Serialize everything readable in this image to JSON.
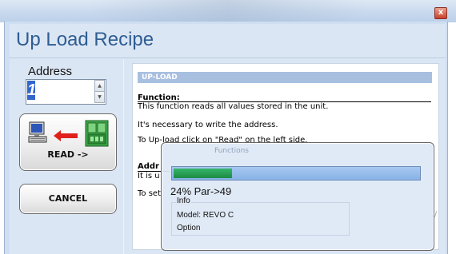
{
  "window": {
    "close_glyph": "x"
  },
  "title": "Up Load Recipe",
  "address": {
    "label": "Address",
    "value": "1"
  },
  "buttons": {
    "read_label": "READ ->",
    "cancel_label": "CANCEL"
  },
  "icons": {
    "pc": "computer-icon",
    "arrow": "red-arrow-left-icon",
    "unit": "unit-device-icon"
  },
  "info": {
    "header": "UP-LOAD",
    "function_title": "Function:",
    "function_text": "This function reads all values stored in the unit.",
    "line2": "It's necessary to write the address.",
    "line3": "To Up-load click on \"Read\" on the left side.",
    "address_title": "Addr",
    "line4": "It is u",
    "line5": "To set"
  },
  "progress": {
    "ghost_title": "Functions",
    "percent": 24,
    "status_text": "24% Par->49",
    "group_title": "Info",
    "model": "Model: REVO C",
    "option": "Option"
  },
  "colors": {
    "title": "#2e5d93",
    "header_bg": "#a8bfe0",
    "progress_fill": "#1d8b44",
    "address_highlight": "#3366cc"
  }
}
